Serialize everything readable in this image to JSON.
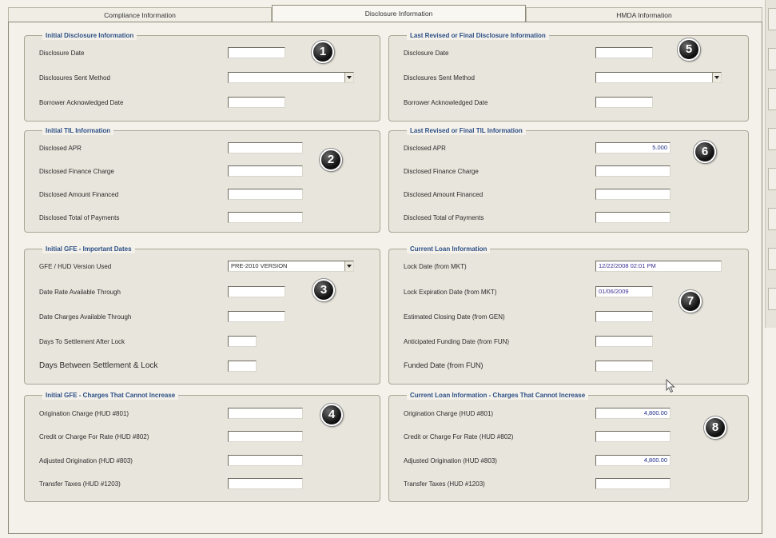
{
  "tabs": [
    {
      "label": "Compliance Information"
    },
    {
      "label": "Disclosure Information"
    },
    {
      "label": "HMDA Information"
    }
  ],
  "groups": {
    "initial_disclosure": {
      "title": "Initial Disclosure Information",
      "badge": "1",
      "rows": [
        {
          "label": "Disclosure Date",
          "value": ""
        },
        {
          "label": "Disclosures Sent Method",
          "value": ""
        },
        {
          "label": "Borrower Acknowledged Date",
          "value": ""
        }
      ]
    },
    "initial_til": {
      "title": "Initial TIL Information",
      "badge": "2",
      "rows": [
        {
          "label": "Disclosed APR",
          "value": ""
        },
        {
          "label": "Disclosed Finance Charge",
          "value": ""
        },
        {
          "label": "Disclosed Amount Financed",
          "value": ""
        },
        {
          "label": "Disclosed Total of Payments",
          "value": ""
        }
      ]
    },
    "initial_gfe_dates": {
      "title": "Initial GFE - Important Dates",
      "badge": "3",
      "rows": [
        {
          "label": "GFE / HUD Version Used",
          "value": "PRE-2010 VERSION"
        },
        {
          "label": "Date Rate Available Through",
          "value": ""
        },
        {
          "label": "Date Charges Available Through",
          "value": ""
        },
        {
          "label": "Days To Settlement After Lock",
          "value": ""
        },
        {
          "label": "Days Between Settlement & Lock",
          "value": ""
        }
      ]
    },
    "initial_gfe_charges": {
      "title": "Initial GFE - Charges That Cannot Increase",
      "badge": "4",
      "rows": [
        {
          "label": "Origination Charge (HUD #801)",
          "value": ""
        },
        {
          "label": "Credit or Charge For Rate (HUD #802)",
          "value": ""
        },
        {
          "label": "Adjusted Origination (HUD #803)",
          "value": ""
        },
        {
          "label": "Transfer Taxes (HUD #1203)",
          "value": ""
        }
      ]
    },
    "final_disclosure": {
      "title": "Last Revised or Final Disclosure Information",
      "badge": "5",
      "rows": [
        {
          "label": "Disclosure Date",
          "value": ""
        },
        {
          "label": "Disclosures Sent Method",
          "value": ""
        },
        {
          "label": "Borrower Acknowledged Date",
          "value": ""
        }
      ]
    },
    "final_til": {
      "title": "Last Revised or Final TIL Information",
      "badge": "6",
      "rows": [
        {
          "label": "Disclosed APR",
          "value": "5.000"
        },
        {
          "label": "Disclosed Finance Charge",
          "value": ""
        },
        {
          "label": "Disclosed Amount Financed",
          "value": ""
        },
        {
          "label": "Disclosed Total of Payments",
          "value": ""
        }
      ]
    },
    "current_loan": {
      "title": "Current Loan Information",
      "badge": "7",
      "rows": [
        {
          "label": "Lock Date (from MKT)",
          "value": "12/22/2008 02:01 PM"
        },
        {
          "label": "Lock Expiration Date (from MKT)",
          "value": "01/06/2009"
        },
        {
          "label": "Estimated Closing Date (from GEN)",
          "value": ""
        },
        {
          "label": "Anticipated Funding Date (from FUN)",
          "value": ""
        },
        {
          "label": "Funded Date (from FUN)",
          "value": ""
        }
      ]
    },
    "current_loan_charges": {
      "title": "Current Loan Information - Charges That Cannot Increase",
      "badge": "8",
      "rows": [
        {
          "label": "Origination Charge (HUD #801)",
          "value": "4,800.00"
        },
        {
          "label": "Credit or Charge For Rate (HUD #802)",
          "value": ""
        },
        {
          "label": "Adjusted Origination (HUD #803)",
          "value": "4,800.00"
        },
        {
          "label": "Transfer Taxes (HUD #1203)",
          "value": ""
        }
      ]
    }
  }
}
